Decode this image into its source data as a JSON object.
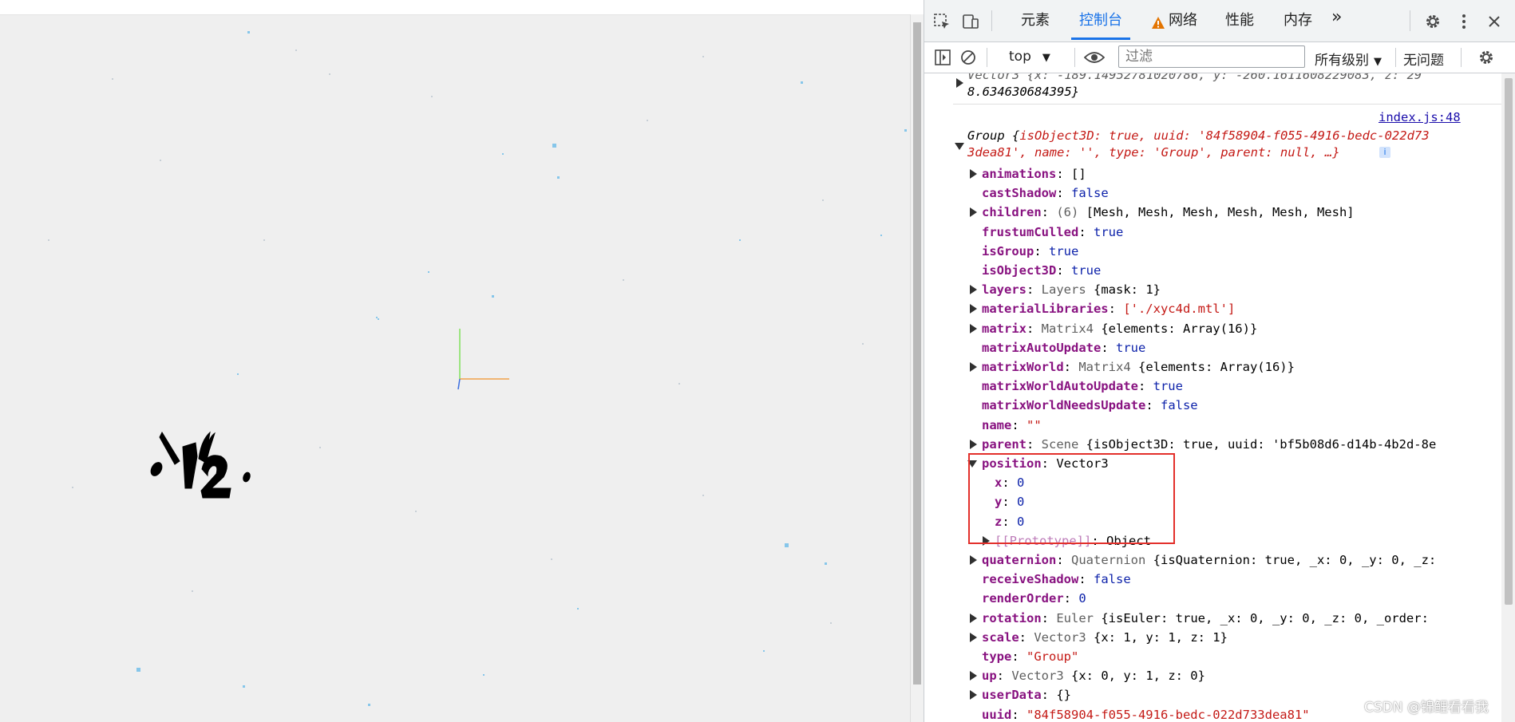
{
  "devtools": {
    "tabs": [
      "元素",
      "控制台",
      "网络",
      "性能",
      "内存"
    ],
    "active_tab": "控制台",
    "more_tabs_glyph": "»",
    "icons": [
      "inspect-element-icon",
      "device-toolbar-icon",
      "warning-icon",
      "settings-icon",
      "more-menu-icon",
      "close-icon"
    ],
    "toolbar": {
      "context": "top",
      "filter_placeholder": "过滤",
      "level": "所有级别",
      "issues": "无问题"
    },
    "log": {
      "prev_line1": "Vector3 {x: -189.14952781020786, y: -260.1611608229083, z: 29",
      "prev_line2": "8.634630684395}",
      "source_link": "index.js:48",
      "group_header_line1_prefix": "Group {",
      "group_header_line1": "isObject3D: true, uuid: '84f58904-f055-4916-bedc-022d73",
      "group_header_line2": "3dea81', name: '', type: 'Group', parent: null, …}",
      "properties": [
        {
          "key": "animations",
          "value": "[]",
          "expandable": true
        },
        {
          "key": "castShadow",
          "value": "false",
          "expandable": false
        },
        {
          "key": "children",
          "value": "(6) [Mesh, Mesh, Mesh, Mesh, Mesh, Mesh]",
          "expandable": true
        },
        {
          "key": "frustumCulled",
          "value": "true",
          "expandable": false
        },
        {
          "key": "isGroup",
          "value": "true",
          "expandable": false
        },
        {
          "key": "isObject3D",
          "value": "true",
          "expandable": false
        },
        {
          "key": "layers",
          "value": "Layers {mask: 1}",
          "expandable": true
        },
        {
          "key": "materialLibraries",
          "value": "['./xyc4d.mtl']",
          "expandable": true
        },
        {
          "key": "matrix",
          "value": "Matrix4 {elements: Array(16)}",
          "expandable": true
        },
        {
          "key": "matrixAutoUpdate",
          "value": "true",
          "expandable": false
        },
        {
          "key": "matrixWorld",
          "value": "Matrix4 {elements: Array(16)}",
          "expandable": true
        },
        {
          "key": "matrixWorldAutoUpdate",
          "value": "true",
          "expandable": false
        },
        {
          "key": "matrixWorldNeedsUpdate",
          "value": "false",
          "expandable": false
        },
        {
          "key": "name",
          "value": "\"\"",
          "expandable": false
        },
        {
          "key": "parent",
          "value": "Scene {isObject3D: true, uuid: 'bf5b08d6-d14b-4b2d-8e",
          "expandable": true
        },
        {
          "key": "position",
          "value": "Vector3",
          "expandable": true,
          "expanded": true
        },
        {
          "key": "quaternion",
          "value": "Quaternion {isQuaternion: true, _x: 0, _y: 0, _z:",
          "expandable": true
        },
        {
          "key": "receiveShadow",
          "value": "false",
          "expandable": false
        },
        {
          "key": "renderOrder",
          "value": "0",
          "expandable": false
        },
        {
          "key": "rotation",
          "value": "Euler {isEuler: true, _x: 0, _y: 0, _z: 0, _order:",
          "expandable": true
        },
        {
          "key": "scale",
          "value": "Vector3 {x: 1, y: 1, z: 1}",
          "expandable": true
        },
        {
          "key": "type",
          "value": "\"Group\"",
          "expandable": false
        },
        {
          "key": "up",
          "value": "Vector3 {x: 0, y: 1, z: 0}",
          "expandable": true
        },
        {
          "key": "userData",
          "value": "{}",
          "expandable": true
        },
        {
          "key": "uuid",
          "value": "\"84f58904-f055-4916-bedc-022d733dea81\"",
          "expandable": false
        }
      ],
      "position_children": [
        {
          "key": "x",
          "value": "0"
        },
        {
          "key": "y",
          "value": "0"
        },
        {
          "key": "z",
          "value": "0"
        },
        {
          "key": "[[Prototype]]",
          "value": "Object"
        }
      ]
    }
  },
  "watermark": "CSDN @锦鲤看看我",
  "colors": {
    "accent": "#1a73e8",
    "highlight_box": "#e3302b",
    "property_key": "#881280",
    "string_value": "#c41a16",
    "boolean_value": "#0d22aa"
  }
}
